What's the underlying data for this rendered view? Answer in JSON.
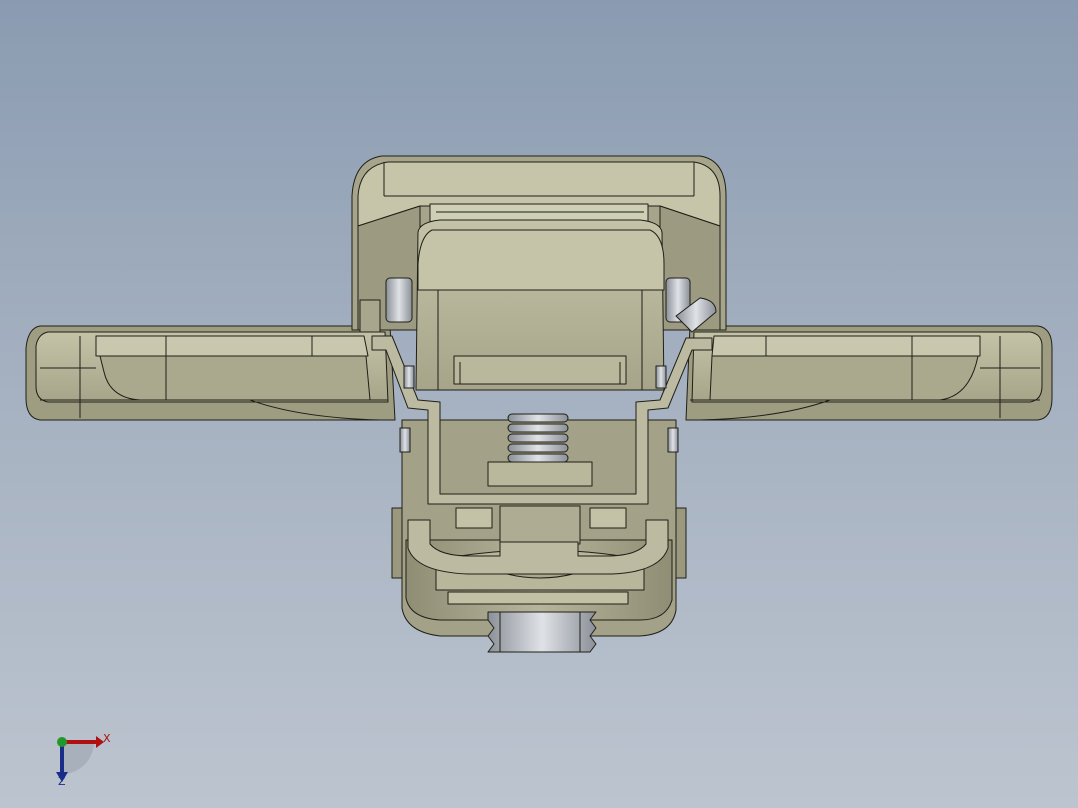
{
  "viewport": {
    "background_top": "#8a9bb1",
    "background_bottom": "#bcc4cf"
  },
  "model": {
    "description_icon": "latch-section-view",
    "colors": {
      "face": "#b3b196",
      "face_light": "#c9c8ae",
      "face_dark": "#8e8c73",
      "edge": "#1f1f17",
      "steel": "#c2c6cc",
      "steel_dark": "#8b9098"
    }
  },
  "triad": {
    "x_label": "X",
    "z_label": "Z",
    "x_color": "#b01010",
    "y_color": "#1f9a2a",
    "z_color": "#1a2c8a"
  }
}
